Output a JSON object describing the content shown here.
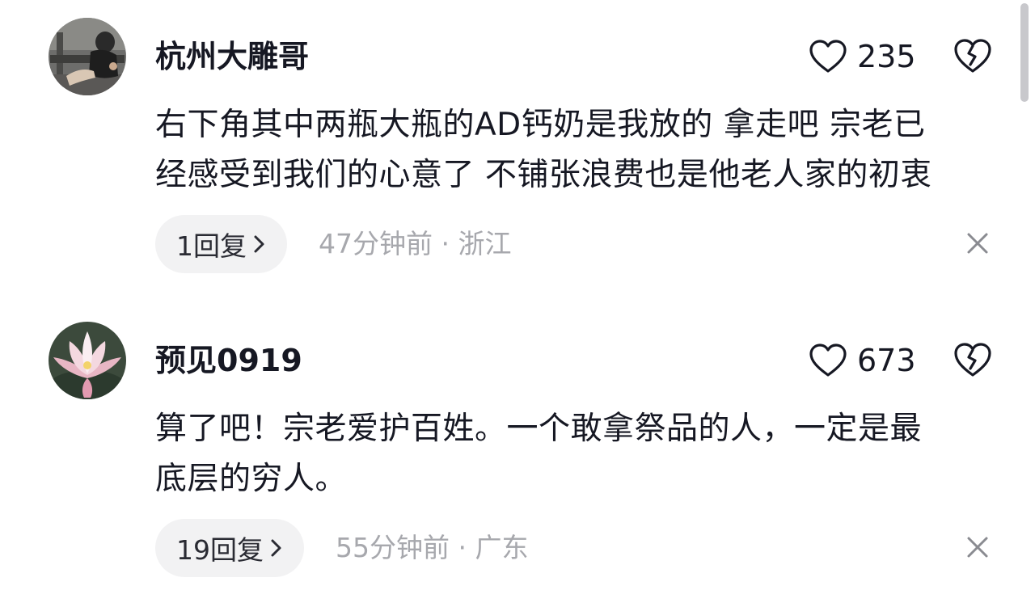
{
  "comments": [
    {
      "username": "杭州大雕哥",
      "likes": "235",
      "body_lines": [
        "右下角其中两瓶大瓶的AD钙奶是我放的 拿走吧 宗老已",
        "经感受到我们的心意了 不铺张浪费也是他老人家的初衷"
      ],
      "reply_label": "1回复",
      "time": "47分钟前",
      "separator": "·",
      "location": "浙江"
    },
    {
      "username": "预见0919",
      "likes": "673",
      "body_lines": [
        "算了吧！宗老爱护百姓。一个敢拿祭品的人，一定是最",
        "底层的穷人。"
      ],
      "reply_label": "19回复",
      "time": "55分钟前",
      "separator": "·",
      "location": "广东"
    }
  ],
  "icons": {
    "like": "heart-outline-icon",
    "dislike": "broken-heart-icon",
    "reply_arrow": "chevron-right-icon",
    "close": "close-icon"
  },
  "colors": {
    "text_primary": "#161823",
    "text_secondary": "#a7a8ad",
    "pill_bg": "#f2f2f3"
  }
}
